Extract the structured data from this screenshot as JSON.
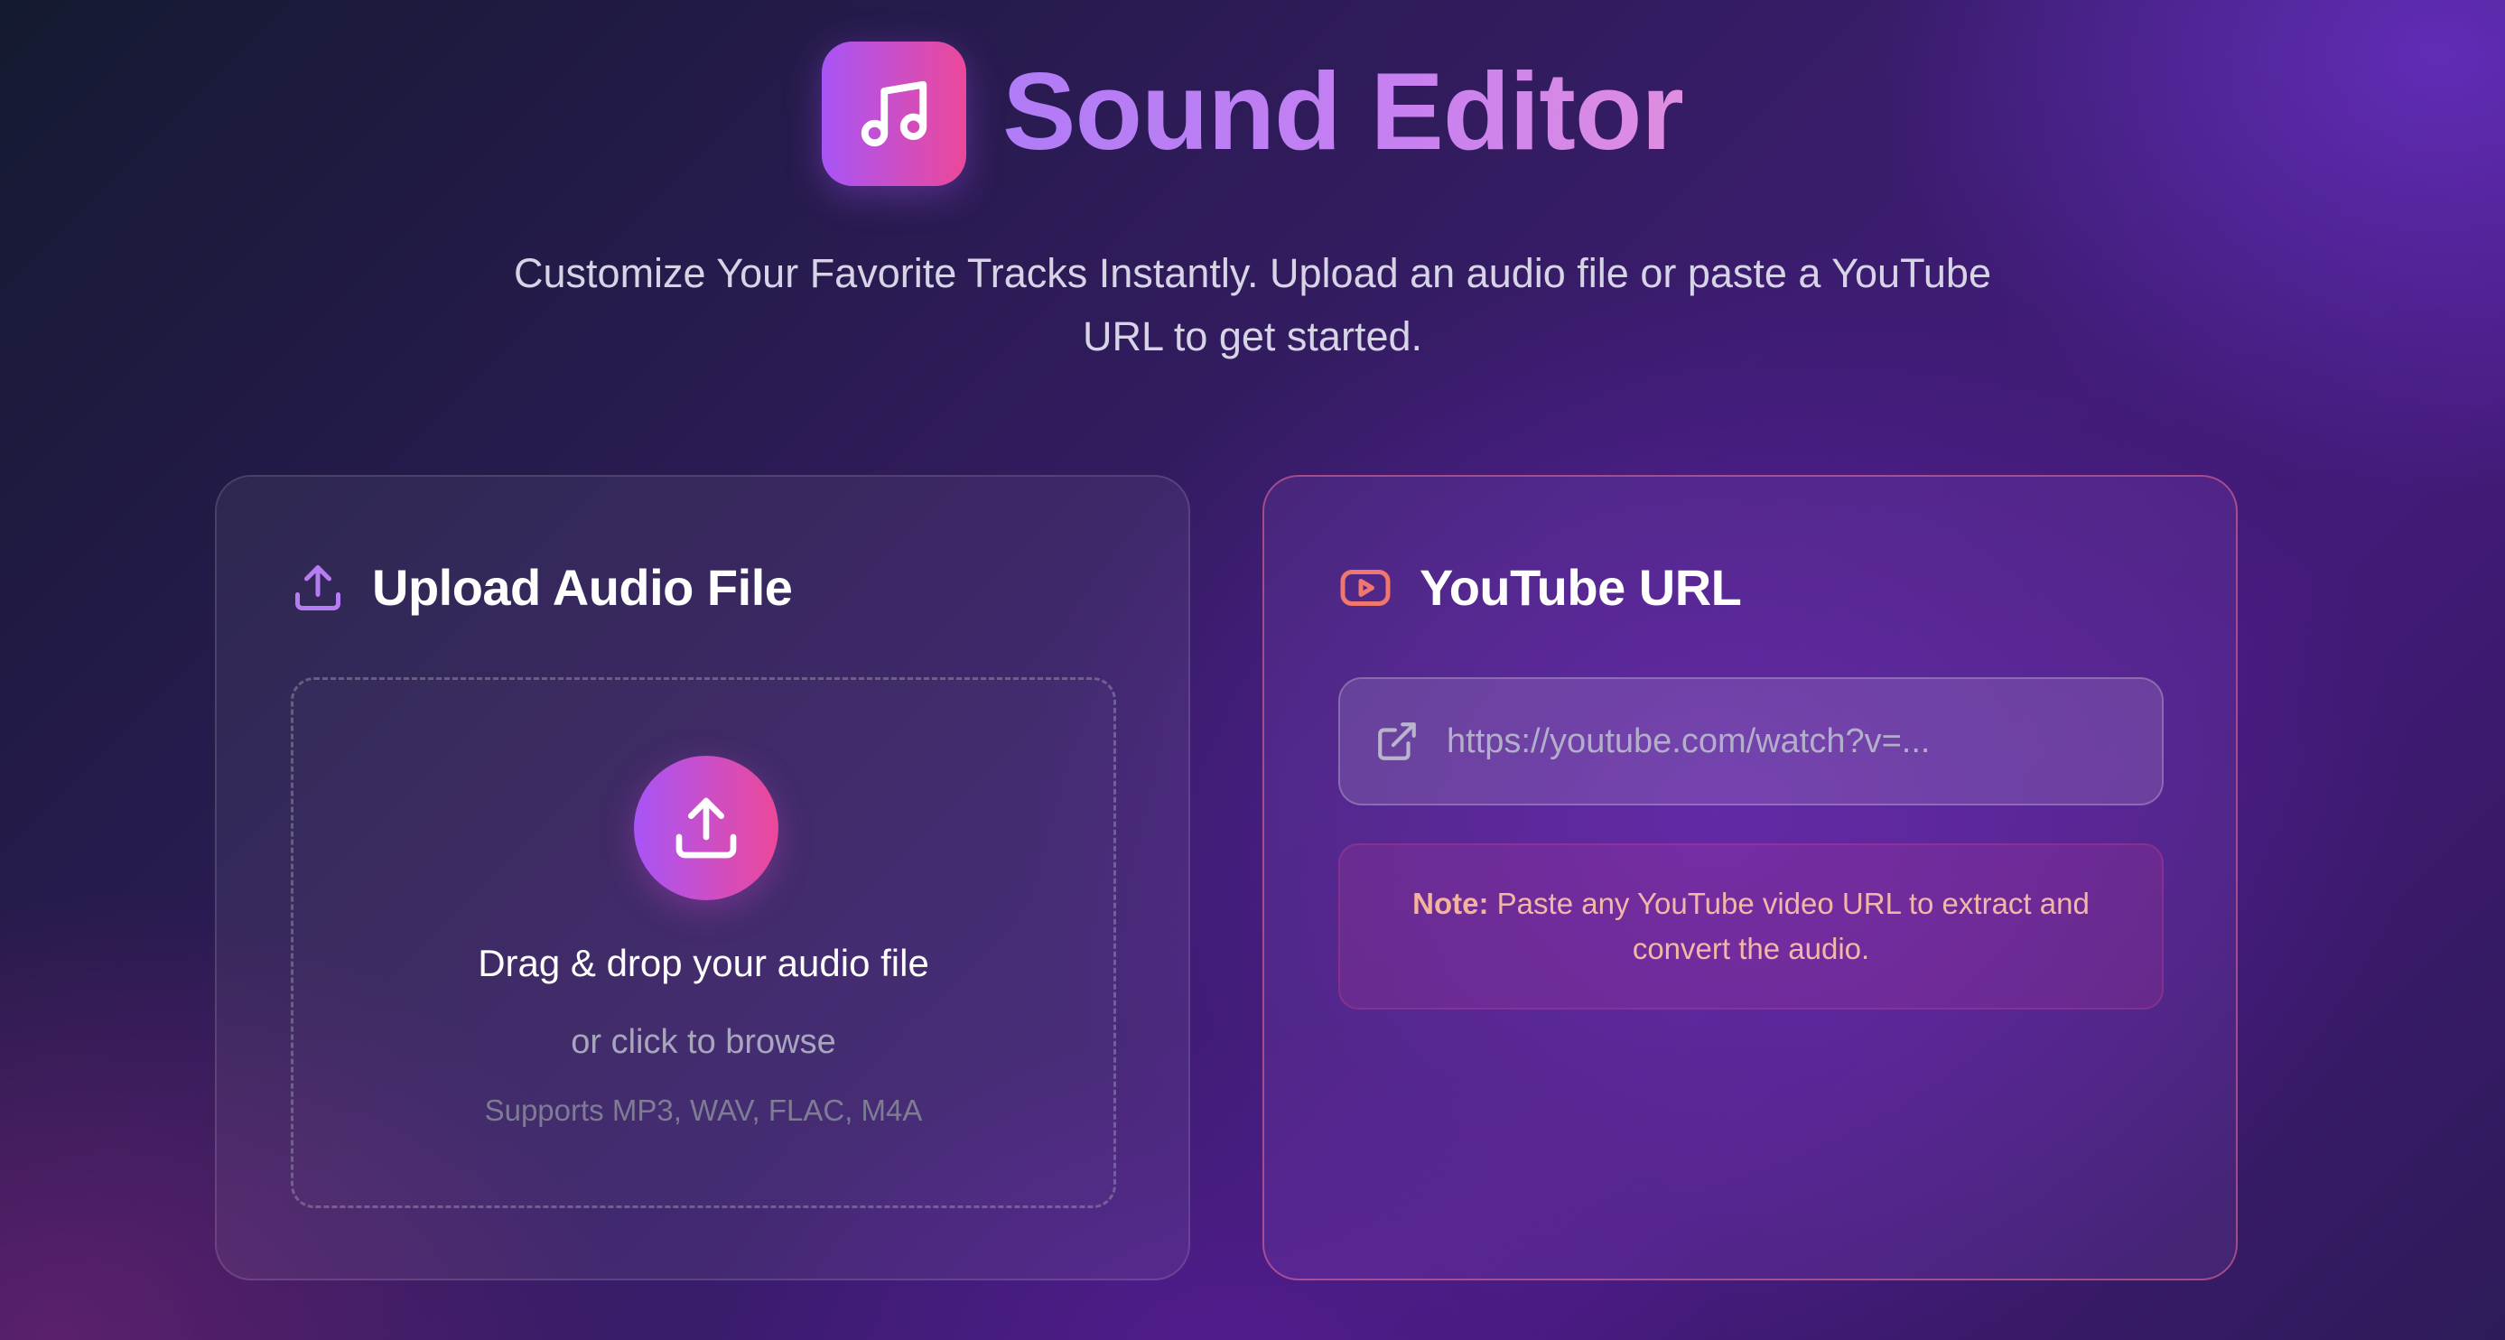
{
  "header": {
    "title": "Sound Editor",
    "logo_icon": "music-note-icon",
    "subtitle": "Customize Your Favorite Tracks Instantly. Upload an audio file or paste a YouTube URL to get started."
  },
  "upload_card": {
    "icon": "upload-icon",
    "title": "Upload Audio File",
    "dropzone": {
      "icon": "upload-icon",
      "title": "Drag & drop your audio file",
      "subtitle": "or click to browse",
      "formats": "Supports MP3, WAV, FLAC, M4A"
    }
  },
  "youtube_card": {
    "icon": "youtube-icon",
    "title": "YouTube URL",
    "input": {
      "icon": "external-link-icon",
      "placeholder": "https://youtube.com/watch?v=...",
      "value": ""
    },
    "note": {
      "label": "Note:",
      "text": "Paste any YouTube video URL to extract and convert the audio."
    }
  },
  "colors": {
    "accent_start": "#a855f7",
    "accent_end": "#ec4899",
    "note_text": "#f3b7a8",
    "youtube_icon": "#f0776e"
  }
}
